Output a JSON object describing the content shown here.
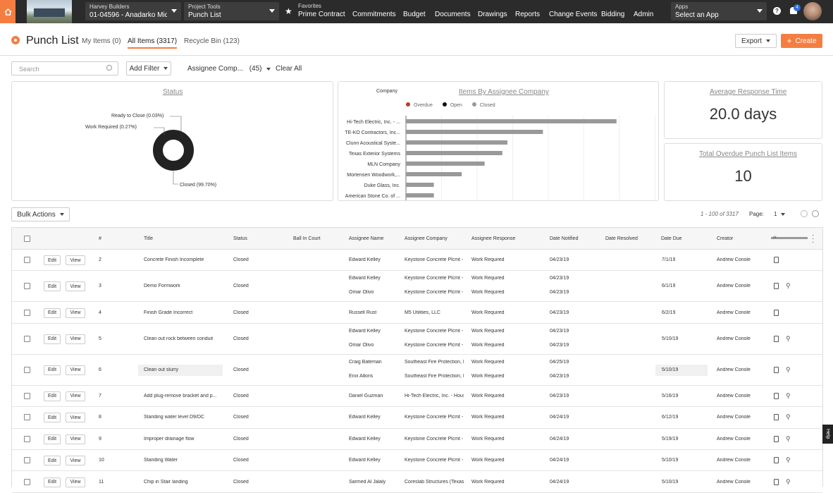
{
  "topbar": {
    "company": "Harvey Builders",
    "project": "01-04596 - Anadarko Mid...",
    "tools_small": "Project Tools",
    "tools_value": "Punch List",
    "favorites_small": "Favorites",
    "favorites_value": "Prime Contract",
    "nav": [
      "Commitments",
      "Budget",
      "Documents",
      "Drawings",
      "Reports",
      "Change Events",
      "Bidding",
      "Admin"
    ],
    "apps_small": "Apps",
    "apps_value": "Select an App",
    "notification_count": "4"
  },
  "header": {
    "title": "Punch List",
    "tabs": [
      "My Items (0)",
      "All Items (3317)",
      "Recycle Bin (123)"
    ],
    "export_label": "Export",
    "create_label": "Create"
  },
  "filters": {
    "search_placeholder": "Search",
    "add_filter": "Add Filter",
    "assignee_company": "Assignee Comp...",
    "assignee_count": "(45)",
    "clear_all": "Clear All"
  },
  "status_card": {
    "title": "Status",
    "labels": [
      "Ready to Close (0.03%)",
      "Work Required (0.27%)",
      "Closed (99.70%)"
    ]
  },
  "company_card": {
    "title": "Items By Assignee Company",
    "axis_label": "Company",
    "legend": [
      "Overdue",
      "Open",
      "Closed"
    ],
    "companies": [
      "Hi-Tech Electric, Inc. - ...",
      "TE-KO Contractors, Inc...",
      "Clunn Acoustical Syste...",
      "Texas Exterior Systems",
      "MLN Company",
      "Mortensen Woodwork,...",
      "Duke Glass, Inc.",
      "American Stone Co. of ..."
    ]
  },
  "response_card": {
    "title": "Average Response Time",
    "value": "20.0 days"
  },
  "overdue_card": {
    "title": "Total Overdue Punch List Items",
    "value": "10"
  },
  "list_controls": {
    "bulk_actions": "Bulk Actions",
    "range": "1 - 100 of 3317",
    "page_label": "Page:",
    "page_value": "1"
  },
  "table": {
    "headers": [
      "#",
      "Title",
      "Status",
      "Ball In Court",
      "Assignee Name",
      "Assignee Company",
      "Assignee Response",
      "Date Notified",
      "Date Resolved",
      "Date Due",
      "Creator"
    ],
    "edit_label": "Edit",
    "view_label": "View",
    "rows": [
      {
        "num": "2",
        "title": "Concrete Finish Incomplete",
        "status": "Closed",
        "assignees": [
          {
            "name": "Edward Kelley",
            "company": "Keystone Concrete Plcmt -",
            "response": "Work Required",
            "notified": "04/23/19"
          }
        ],
        "due": "7/1/19",
        "creator": "Andrew Conole"
      },
      {
        "num": "3",
        "title": "Demo Formwork",
        "status": "Closed",
        "assignees": [
          {
            "name": "Edward Kelley",
            "company": "Keystone Concrete Plcmt -",
            "response": "Work Required",
            "notified": "04/23/19"
          },
          {
            "name": "Omar Olivo",
            "company": "Keystone Concrete Plcmt -",
            "response": "Work Required",
            "notified": "04/23/19"
          }
        ],
        "due": "6/1/19",
        "creator": "Andrew Conole"
      },
      {
        "num": "4",
        "title": "Finish Grade Incorrect",
        "status": "Closed",
        "assignees": [
          {
            "name": "Russell Rust",
            "company": "M5 Utilities, LLC",
            "response": "Work Required",
            "notified": "04/23/19"
          }
        ],
        "due": "6/2/19",
        "creator": "Andrew Conole"
      },
      {
        "num": "5",
        "title": "Clean out rock between conduit",
        "status": "Closed",
        "assignees": [
          {
            "name": "Edward Kelley",
            "company": "Keystone Concrete Plcmt -",
            "response": "Work Required",
            "notified": "04/23/19"
          },
          {
            "name": "Omar Olivo",
            "company": "Keystone Concrete Plcmt -",
            "response": "Work Required",
            "notified": "04/23/19"
          }
        ],
        "due": "5/10/19",
        "creator": "Andrew Conole"
      },
      {
        "num": "6",
        "title": "Clean out slurry",
        "status": "Closed",
        "assignees": [
          {
            "name": "Craig Bateman",
            "company": "Southeast Fire Protection, L",
            "response": "Work Required",
            "notified": "04/25/19"
          },
          {
            "name": "Enix Atkins",
            "company": "Southeast Fire Protection, L",
            "response": "Work Required",
            "notified": "04/23/19"
          }
        ],
        "due": "5/10/19",
        "creator": "Andrew Conole"
      },
      {
        "num": "7",
        "title": "Add plug-remove bracket and p...",
        "status": "Closed",
        "assignees": [
          {
            "name": "Daniel Guzman",
            "company": "Hi-Tech Electric, Inc. - Hous",
            "response": "Work Required",
            "notified": "04/23/19"
          }
        ],
        "due": "5/16/19",
        "creator": "Andrew Conole"
      },
      {
        "num": "8",
        "title": "Standing water level D9/DC",
        "status": "Closed",
        "assignees": [
          {
            "name": "Edward Kelley",
            "company": "Keystone Concrete Plcmt -",
            "response": "Work Required",
            "notified": "04/24/19"
          }
        ],
        "due": "6/12/19",
        "creator": "Andrew Conole"
      },
      {
        "num": "9",
        "title": "Improper drainage flow",
        "status": "Closed",
        "assignees": [
          {
            "name": "Edward Kelley",
            "company": "Keystone Concrete Plcmt -",
            "response": "Work Required",
            "notified": "04/24/19"
          }
        ],
        "due": "5/19/19",
        "creator": "Andrew Conole"
      },
      {
        "num": "10",
        "title": "Standing Water",
        "status": "Closed",
        "assignees": [
          {
            "name": "Edward Kelley",
            "company": "Keystone Concrete Plcmt -",
            "response": "Work Required",
            "notified": "04/24/19"
          }
        ],
        "due": "5/10/19",
        "creator": "Andrew Conole"
      },
      {
        "num": "11",
        "title": "Chip in Stair landing",
        "status": "Closed",
        "assignees": [
          {
            "name": "Sarmed Al Jalaly",
            "company": "Coreslab Structures (Texas)",
            "response": "Work Required",
            "notified": "04/24/19"
          }
        ],
        "due": "5/10/19",
        "creator": "Andrew Conole"
      }
    ]
  },
  "help_label": "Help"
}
